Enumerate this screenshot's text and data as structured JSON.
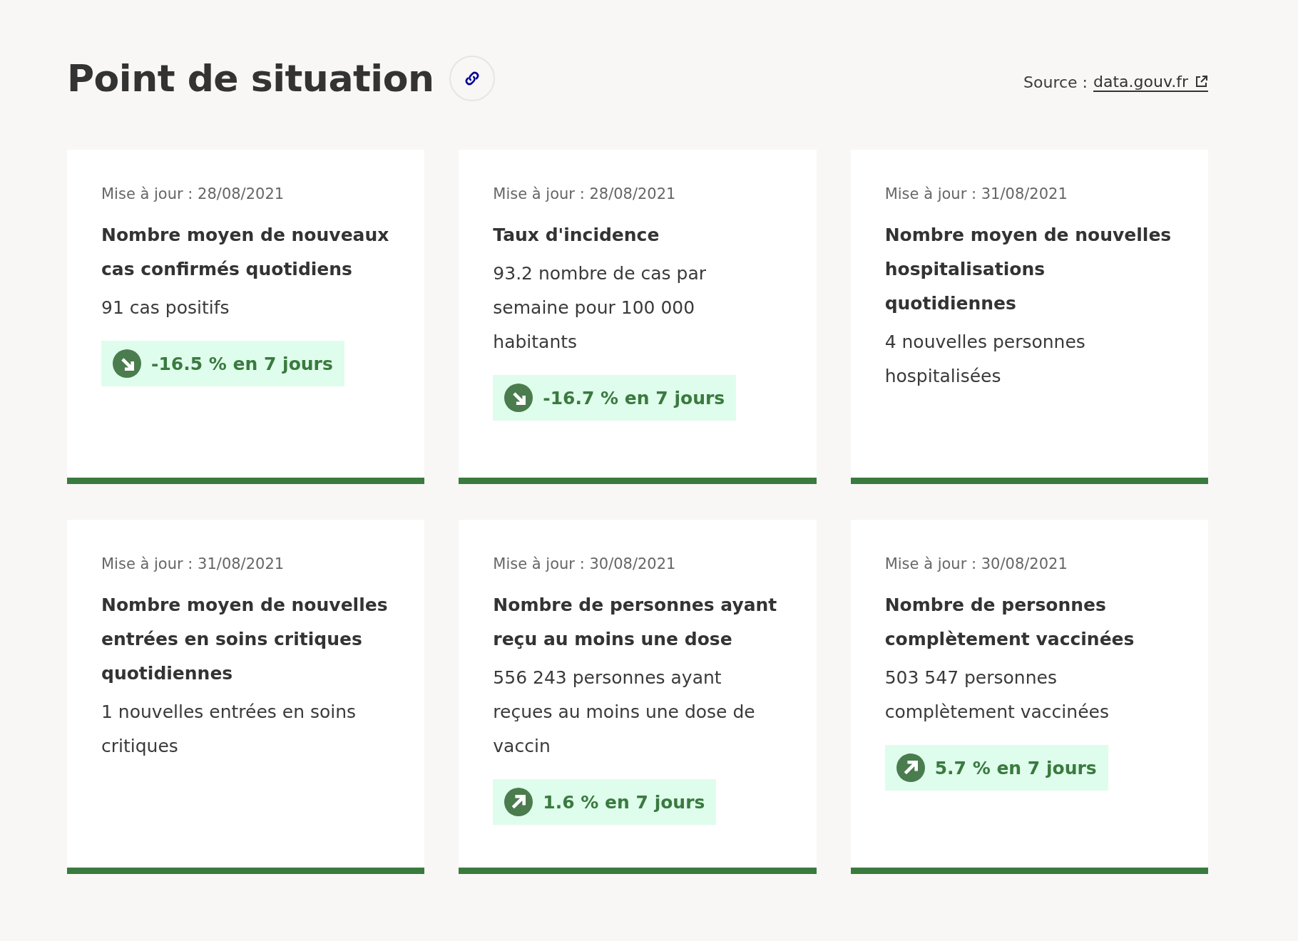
{
  "header": {
    "title": "Point de situation",
    "source_label": "Source :",
    "source_link": "data.gouv.fr"
  },
  "cards": [
    {
      "updated": "Mise à jour : 28/08/2021",
      "title": "Nombre moyen de nouveaux cas confirmés quotidiens",
      "value": "91 cas positifs",
      "trend": {
        "kind": "down",
        "text": "-16.5 % en 7 jours"
      }
    },
    {
      "updated": "Mise à jour : 28/08/2021",
      "title": "Taux d'incidence",
      "value": "93.2 nombre de cas par semaine pour 100 000 habitants",
      "trend": {
        "kind": "down",
        "text": "-16.7 % en 7 jours"
      }
    },
    {
      "updated": "Mise à jour : 31/08/2021",
      "title": "Nombre moyen de nouvelles hospitalisations quotidiennes",
      "value": "4 nouvelles personnes hospitalisées"
    },
    {
      "updated": "Mise à jour : 31/08/2021",
      "title": "Nombre moyen de nouvelles entrées en soins critiques quotidiennes",
      "value": "1 nouvelles entrées en soins critiques"
    },
    {
      "updated": "Mise à jour : 30/08/2021",
      "title": "Nombre de personnes ayant reçu au moins une dose",
      "value": "556 243 personnes ayant reçues au moins une dose de vaccin",
      "trend": {
        "kind": "up",
        "text": "1.6 % en 7 jours"
      }
    },
    {
      "updated": "Mise à jour : 30/08/2021",
      "title": "Nombre de personnes complètement vaccinées",
      "value": "503 547 personnes complètement vaccinées",
      "trend": {
        "kind": "up",
        "text": "5.7 % en 7 jours"
      }
    }
  ]
}
